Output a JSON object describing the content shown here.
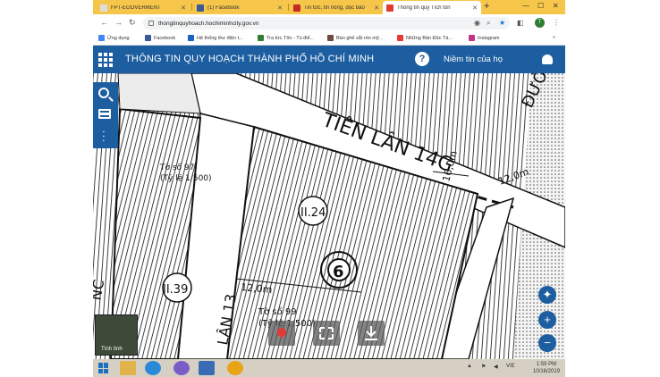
{
  "browser": {
    "tabs": [
      {
        "title": "FPT-EGOVERMENT",
        "icon": "fpt-icon",
        "color": "#e6e6e6"
      },
      {
        "title": "(1) Facebook",
        "icon": "facebook-icon",
        "color": "#3b5998"
      },
      {
        "title": "Tin tức, tin nóng, đọc báo",
        "icon": "news-icon",
        "color": "#c62828"
      },
      {
        "title": "Thông tin quy Tích tôn",
        "icon": "planning-icon",
        "color": "#e53935"
      }
    ],
    "new_tab": "+",
    "address": "thongtinquyhoach.hochiminhcity.gov.vn",
    "avatar_letter": "T",
    "bookmarks": [
      {
        "label": "Ứng dụng",
        "color": "#4285f4"
      },
      {
        "label": "Facebook",
        "color": "#3b5998"
      },
      {
        "label": "Hệ thống thư điện t...",
        "color": "#1565c0"
      },
      {
        "label": "Tra tức Tôn - Tú điể...",
        "color": "#2e7d32"
      },
      {
        "label": "Bàn ghế sắt rèn mỹ...",
        "color": "#6d4c41"
      },
      {
        "label": "Những Bản Độc Tả...",
        "color": "#e53935"
      },
      {
        "label": "Instagram",
        "color": "#c13584"
      }
    ]
  },
  "app": {
    "title": "THÔNG TIN QUY HOẠCH THÀNH PHỐ HỒ CHÍ MINH",
    "help": "?",
    "user_label": "Niềm tin của họ",
    "brand_color": "#1c5ea0"
  },
  "map": {
    "street_label": "TIÊN LÂN 14G",
    "street_label_right": "ĐƯỜNG",
    "parcels": [
      {
        "label": "II.24"
      },
      {
        "label": "II.39"
      }
    ],
    "parcel_number": "6",
    "sheet_top": "Tờ số 97",
    "scale_top": "(Tỷ lệ 1/500)",
    "sheet_bottom": "Tờ số 99",
    "scale_bottom": "(Tỷ lệ 1/500)",
    "width_labels": [
      "16,0m",
      "12,0m",
      "12,0m"
    ],
    "road_bottom": "LÂN 13",
    "left_edge": "NC",
    "minimap_label": "Tình tình"
  },
  "taskbar": {
    "language": "VIE",
    "time": "1:59 PM",
    "date": "10/16/2019"
  }
}
